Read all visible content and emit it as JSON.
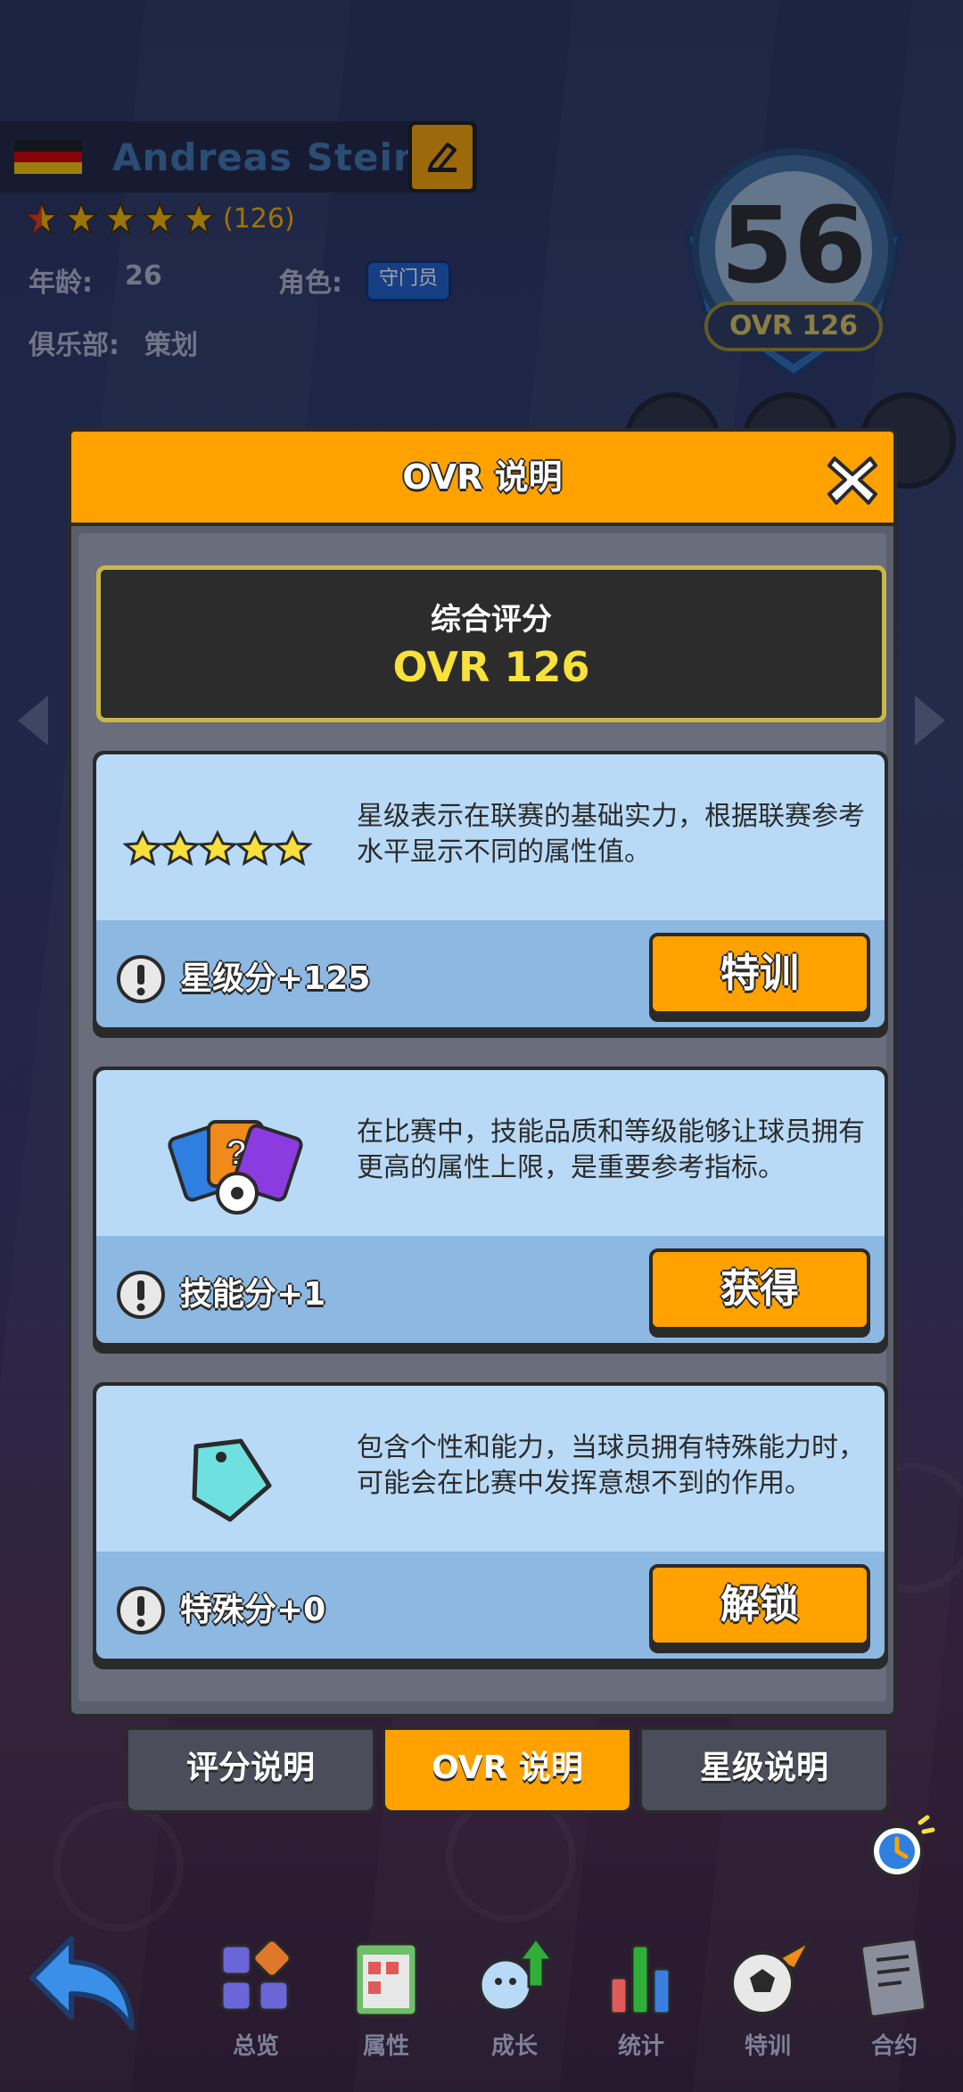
{
  "player": {
    "name": "Andreas Stein",
    "stars_count_text": "(126)",
    "age_label": "年龄:",
    "age_value": "26",
    "role_label": "角色:",
    "role_value": "守门员",
    "club_label": "俱乐部:",
    "club_value": "策划",
    "rating": "56",
    "ovr_badge": "OVR 126"
  },
  "modal": {
    "title": "OVR 说明",
    "overall_label": "综合评分",
    "overall_value": "OVR 126",
    "cards": [
      {
        "description": "星级表示在联赛的基础实力，根据联赛参考水平显示不同的属性值。",
        "score": "星级分+125",
        "button": "特训",
        "icon": "five-stars-icon"
      },
      {
        "description": "在比赛中，技能品质和等级能够让球员拥有更高的属性上限，是重要参考指标。",
        "score": "技能分+1",
        "button": "获得",
        "icon": "skill-cards-icon"
      },
      {
        "description": "包含个性和能力，当球员拥有特殊能力时，可能会在比赛中发挥意想不到的作用。",
        "score": "特殊分+0",
        "button": "解锁",
        "icon": "tag-icon"
      }
    ]
  },
  "tabs": [
    {
      "label": "评分说明",
      "active": false
    },
    {
      "label": "OVR 说明",
      "active": true
    },
    {
      "label": "星级说明",
      "active": false
    }
  ],
  "nav": [
    {
      "label": "总览",
      "icon": "overview-icon"
    },
    {
      "label": "属性",
      "icon": "attributes-icon"
    },
    {
      "label": "成长",
      "icon": "growth-icon"
    },
    {
      "label": "统计",
      "icon": "stats-icon"
    },
    {
      "label": "特训",
      "icon": "training-icon"
    },
    {
      "label": "合约",
      "icon": "contract-icon"
    }
  ],
  "colors": {
    "accent": "#ffa200",
    "star": "#f2b300",
    "ovr_value": "#f7e13a",
    "card_light": "#b8daf7",
    "card_dark": "#8cb8e2"
  }
}
